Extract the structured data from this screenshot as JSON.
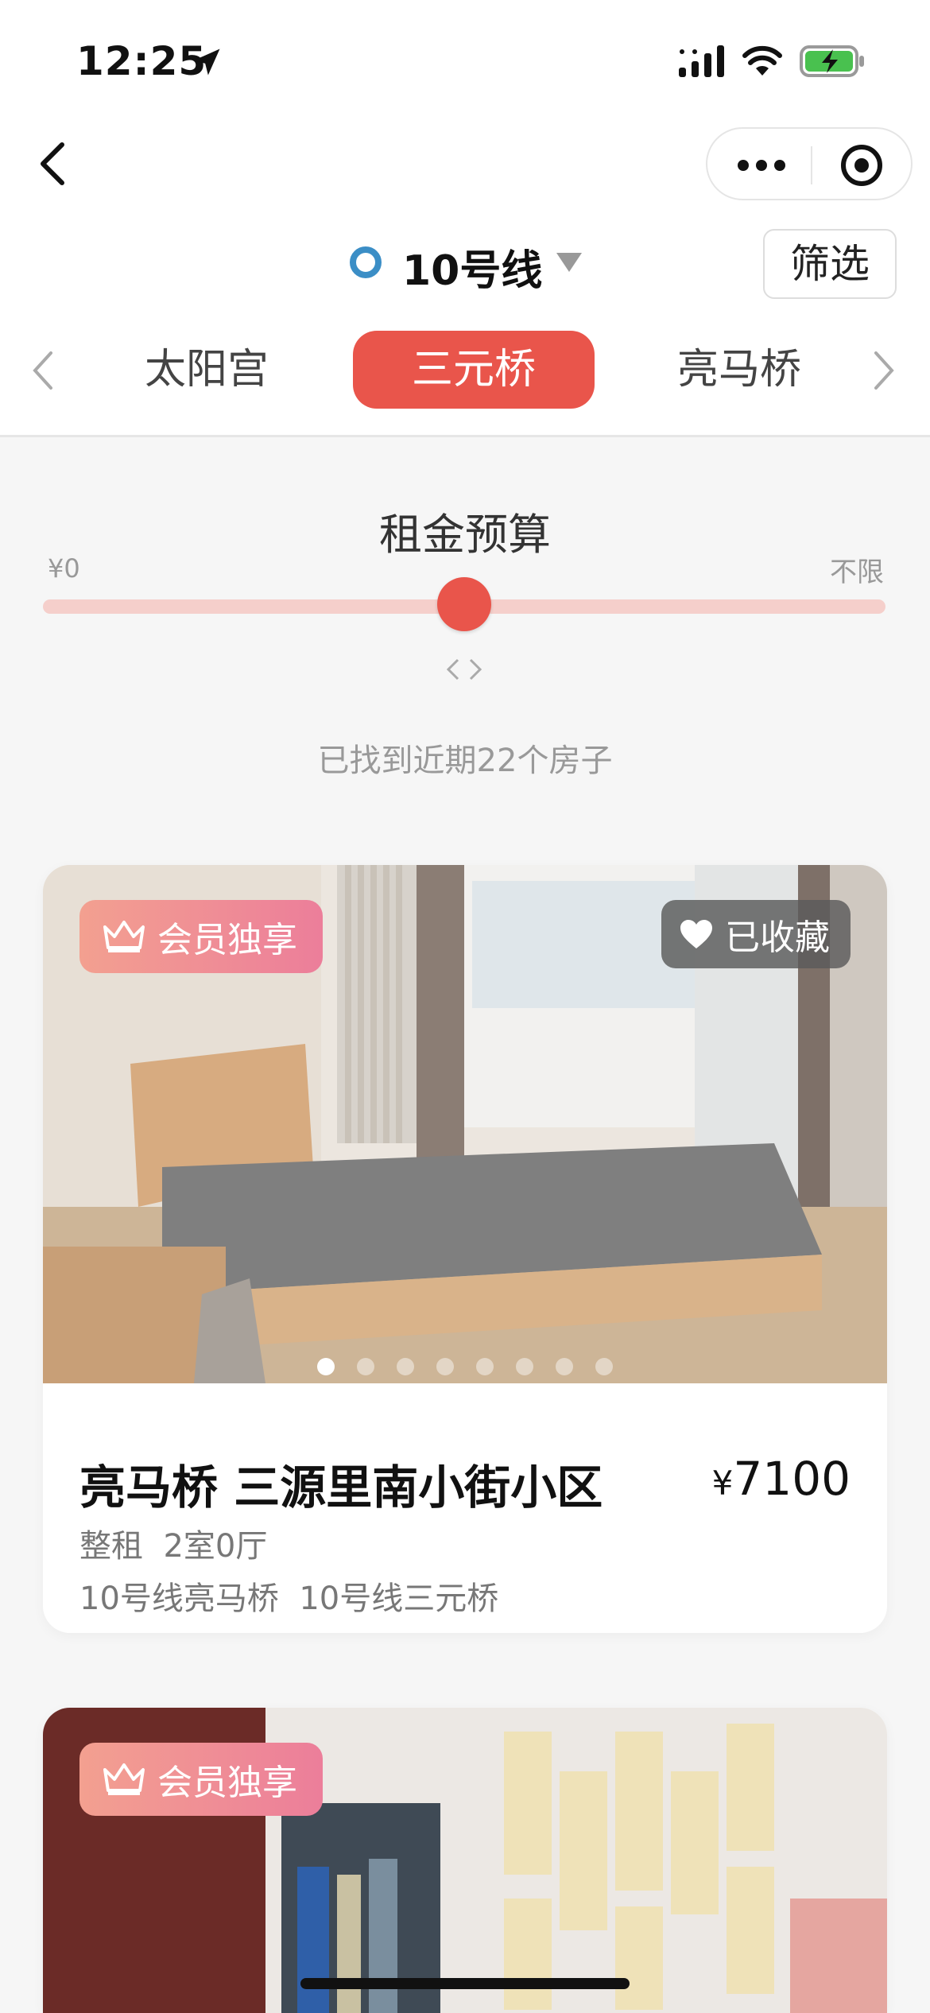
{
  "status": {
    "time": "12:25"
  },
  "line_selector": {
    "name": "10号线",
    "filter_label": "筛选",
    "line_color": "#3b8ec6"
  },
  "stations": {
    "items": [
      "太阳宫",
      "三元桥",
      "亮马桥"
    ],
    "active": "三元桥",
    "accent": "#e9554b"
  },
  "budget": {
    "title": "租金预算",
    "min_label": "¥0",
    "max_label": "不限",
    "slider_level": 0.5
  },
  "results": {
    "found_text": "已找到近期22个房子"
  },
  "listings": [
    {
      "vip_badge": "会员独享",
      "fav_badge": "已收藏",
      "title": "亮马桥 三源里南小街小区",
      "price_symbol": "¥",
      "price": "7100",
      "rent_type": "整租",
      "layout": "2室0厅",
      "lines": [
        "10号线亮马桥",
        "10号线三元桥"
      ],
      "photo_count": 8,
      "current_photo": 1
    },
    {
      "vip_badge": "会员独享"
    }
  ]
}
